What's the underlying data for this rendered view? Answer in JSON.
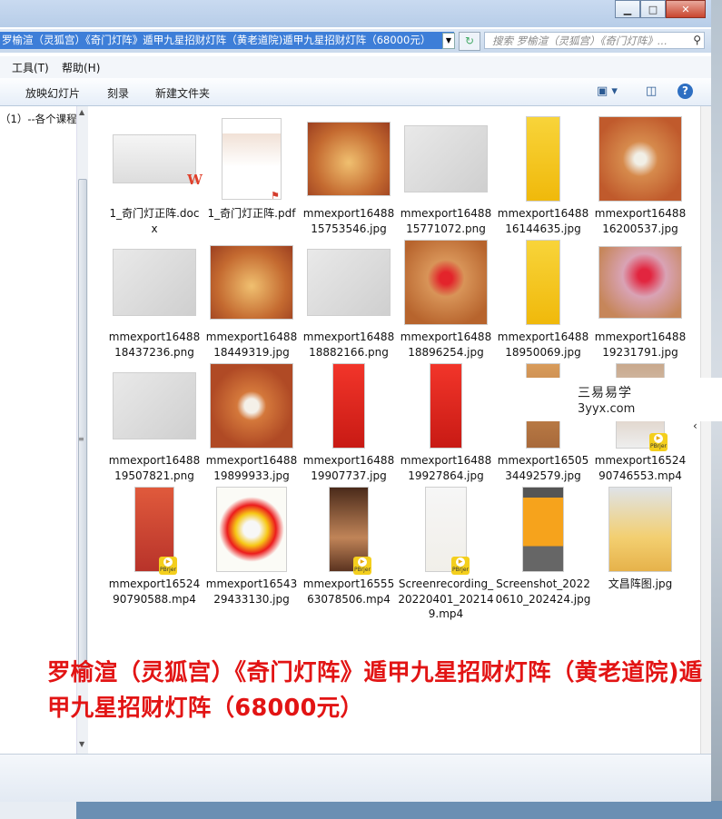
{
  "address": {
    "path": "罗榆渲（灵狐宫）《奇门灯阵》遁甲九星招财灯阵（黄老道院)遁甲九星招财灯阵（68000元）"
  },
  "search": {
    "placeholder": "搜索 罗榆渲（灵狐宫）《奇门灯阵》..."
  },
  "menu": {
    "tools": "工具(T)",
    "help": "帮助(H)"
  },
  "toolbar": {
    "slideshow": "放映幻灯片",
    "burn": "刻录",
    "new_folder": "新建文件夹"
  },
  "nav": {
    "item": "（1）--各个课程"
  },
  "files": [
    {
      "name": "1_奇门灯正阵.docx",
      "kind": "docx"
    },
    {
      "name": "1_奇门灯正阵.pdf",
      "kind": "pdf"
    },
    {
      "name": "mmexport1648815753546.jpg",
      "kind": "jpg-red"
    },
    {
      "name": "mmexport1648815771072.png",
      "kind": "png-sketch"
    },
    {
      "name": "mmexport1648816144635.jpg",
      "kind": "talisman-yellow"
    },
    {
      "name": "mmexport1648816200537.jpg",
      "kind": "grid-white"
    },
    {
      "name": "mmexport1648818437236.png",
      "kind": "png-sketch"
    },
    {
      "name": "mmexport1648818449319.jpg",
      "kind": "jpg-red"
    },
    {
      "name": "mmexport1648818882166.png",
      "kind": "png-sketch"
    },
    {
      "name": "mmexport1648818896254.jpg",
      "kind": "grid-red"
    },
    {
      "name": "mmexport1648818950069.jpg",
      "kind": "talisman-yellow"
    },
    {
      "name": "mmexport1648819231791.jpg",
      "kind": "grid-pink"
    },
    {
      "name": "mmexport1648819507821.png",
      "kind": "png-sketch"
    },
    {
      "name": "mmexport1648819899933.jpg",
      "kind": "jpg-orange"
    },
    {
      "name": "mmexport1648819907737.jpg",
      "kind": "talisman-red"
    },
    {
      "name": "mmexport1648819927864.jpg",
      "kind": "talisman-red"
    },
    {
      "name": "mmexport1650534492579.jpg",
      "kind": "hidden"
    },
    {
      "name": "mmexport1652490746553.mp4",
      "kind": "mp4-hidden"
    },
    {
      "name": "mmexport1652490790588.mp4",
      "kind": "mp4-red"
    },
    {
      "name": "mmexport1654329433130.jpg",
      "kind": "cross-yellow"
    },
    {
      "name": "mmexport1655563078506.mp4",
      "kind": "mp4-dark"
    },
    {
      "name": "Screenrecording_20220401_202149.mp4",
      "kind": "mp4-screen"
    },
    {
      "name": "Screenshot_20220610_202424.jpg",
      "kind": "shot-orange"
    },
    {
      "name": "文昌阵图.jpg",
      "kind": "shrine"
    }
  ],
  "badge_text": "PBrjer",
  "watermark": {
    "line1": "三易易学",
    "line2": "3yyx.com"
  },
  "caption": "罗榆渲（灵狐宫）《奇门灯阵》遁甲九星招财灯阵（黄老道院)遁甲九星招财灯阵（68000元）",
  "icons": [
    "minimize-icon",
    "maximize-icon",
    "close-icon",
    "refresh-icon",
    "search-icon",
    "view-icon",
    "preview-pane-icon",
    "help-icon"
  ],
  "colors": {
    "caption": "#e21414",
    "address_highlight": "#3d7ed8",
    "talisman_yellow": "#f4c20d",
    "talisman_red": "#e8251f"
  }
}
